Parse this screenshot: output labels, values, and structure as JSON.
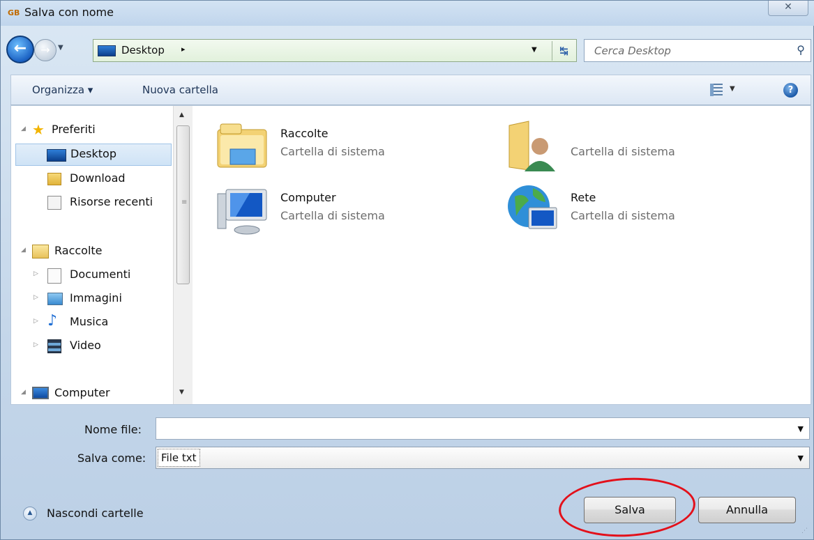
{
  "window": {
    "title": "Salva con nome",
    "close_glyph": "✕"
  },
  "nav": {
    "address_location": "Desktop",
    "address_separator": "▸",
    "search_placeholder": "Cerca Desktop"
  },
  "toolbar": {
    "organize_label": "Organizza ▾",
    "new_folder_label": "Nuova cartella",
    "help_glyph": "?"
  },
  "sidebar": {
    "items": [
      {
        "label": "Preferiti",
        "icon": "star-icon"
      },
      {
        "label": "Desktop",
        "icon": "desktop-icon",
        "selected": true
      },
      {
        "label": "Download",
        "icon": "download-folder-icon"
      },
      {
        "label": "Risorse recenti",
        "icon": "recent-places-icon"
      },
      {
        "label": "Raccolte",
        "icon": "libraries-icon"
      },
      {
        "label": "Documenti",
        "icon": "documents-icon"
      },
      {
        "label": "Immagini",
        "icon": "pictures-icon"
      },
      {
        "label": "Musica",
        "icon": "music-icon"
      },
      {
        "label": "Video",
        "icon": "video-icon"
      },
      {
        "label": "Computer",
        "icon": "computer-icon"
      }
    ]
  },
  "files": {
    "items": [
      {
        "name": "Raccolte",
        "desc": "Cartella di sistema",
        "icon": "libraries-folder-icon"
      },
      {
        "name": "",
        "desc": "Cartella di sistema",
        "icon": "user-folder-icon"
      },
      {
        "name": "Computer",
        "desc": "Cartella di sistema",
        "icon": "computer-icon"
      },
      {
        "name": "Rete",
        "desc": "Cartella di sistema",
        "icon": "network-icon"
      }
    ]
  },
  "form": {
    "filename_label": "Nome file:",
    "filename_value": "",
    "savetype_label": "Salva come:",
    "savetype_value": "File txt"
  },
  "footer": {
    "hide_folders_label": "Nascondi cartelle",
    "save_label": "Salva",
    "cancel_label": "Annulla"
  },
  "colors": {
    "highlight_ring": "#e3101a",
    "window_chrome": "#c5d7ea"
  }
}
